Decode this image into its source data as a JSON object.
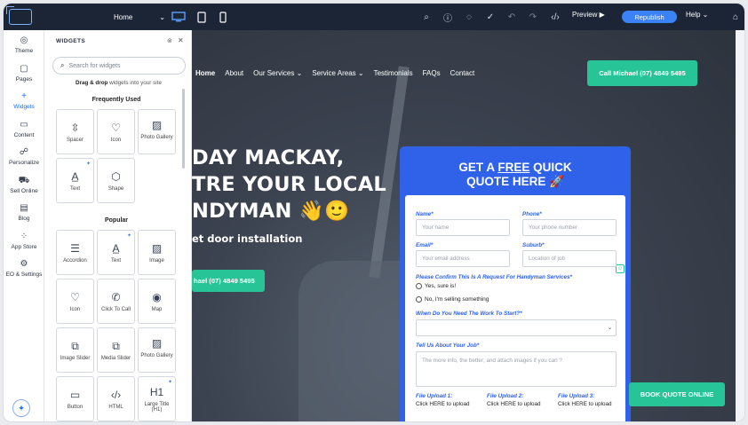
{
  "topbar": {
    "page_select": "Home",
    "preview_label": "Preview ▶",
    "republish_label": "Republish",
    "help_label": "Help"
  },
  "rail": {
    "items": [
      {
        "label": "Theme"
      },
      {
        "label": "Pages"
      },
      {
        "label": "Widgets"
      },
      {
        "label": "Content"
      },
      {
        "label": "Personalize"
      },
      {
        "label": "Sell Online"
      },
      {
        "label": "Blog"
      },
      {
        "label": "App Store"
      },
      {
        "label": "EO & Settings"
      }
    ]
  },
  "panel": {
    "title": "WIDGETS",
    "search_placeholder": "Search for widgets",
    "hint_bold": "Drag & drop",
    "hint_rest": " widgets into your site",
    "frequent_title": "Frequently Used",
    "frequent": [
      {
        "label": "Spacer"
      },
      {
        "label": "Icon"
      },
      {
        "label": "Photo Gallery"
      },
      {
        "label": "Text"
      },
      {
        "label": "Shape"
      }
    ],
    "popular_title": "Popular",
    "popular": [
      {
        "label": "Accordion"
      },
      {
        "label": "Text"
      },
      {
        "label": "Image"
      },
      {
        "label": "Icon"
      },
      {
        "label": "Click To Call"
      },
      {
        "label": "Map"
      },
      {
        "label": "Image Slider"
      },
      {
        "label": "Media Slider"
      },
      {
        "label": "Photo Gallery"
      },
      {
        "label": "Button"
      },
      {
        "label": "HTML"
      },
      {
        "label": "Large Title (H1)"
      }
    ]
  },
  "site": {
    "nav": [
      "Home",
      "About",
      "Our Services ⌄",
      "Service Areas ⌄",
      "Testimonials",
      "FAQs",
      "Contact"
    ],
    "call_top": "Call Michael (07) 4849 5495",
    "hero_line1": "DAY MACKAY,",
    "hero_line2": "TRE YOUR LOCAL",
    "hero_line3": "NDYMAN 👋🙂",
    "hero_sub": "et door installation",
    "call_hero": "hael (07) 4849 5495",
    "quote_title_a": "GET A ",
    "quote_title_u": "FREE",
    "quote_title_b": " QUICK",
    "quote_title_line2": "QUOTE HERE 🚀",
    "form": {
      "name_label": "Name*",
      "name_ph": "Your name",
      "phone_label": "Phone*",
      "phone_ph": "Your phone number",
      "email_label": "Email*",
      "email_ph": "Your email address",
      "suburb_label": "Suburb*",
      "suburb_ph": "Location of job",
      "confirm_label": "Please Confirm This Is A Request For Handyman Services*",
      "radio_yes": "Yes, sure is!",
      "radio_no": "No, I'm selling something",
      "when_label": "When Do You Need The Work To Start?*",
      "job_label": "Tell Us About Your Job*",
      "job_ph": "The more info, the better; and attach images if you can ?",
      "upload1_h": "File Upload 1:",
      "upload2_h": "File Upload 2:",
      "upload3_h": "File Upload 3:",
      "upload_text": "Click HERE to upload"
    },
    "book_label": "BOOK QUOTE ONLINE"
  }
}
